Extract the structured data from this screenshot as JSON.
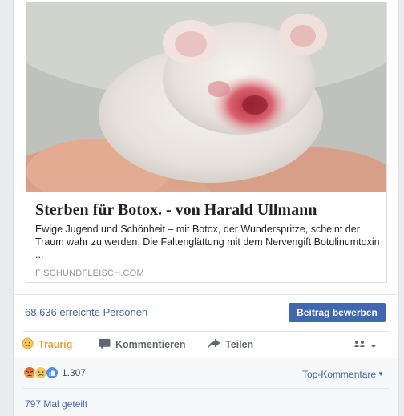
{
  "link": {
    "title": "Sterben für Botox. - von Harald Ullmann",
    "description": "Ewige Jugend und Schönheit – mit Botox, der Wunderspritze, scheint der Traum wahr zu werden. Die Faltenglättung mit dem Nervengift Botulinumtoxin ...",
    "source": "FISCHUNDFLEISCH.COM",
    "image": "white-mouse-with-inflamed-eye-photo"
  },
  "insights": {
    "reach": "68.636 erreichte Personen",
    "promote_label": "Beitrag bewerben"
  },
  "actions": {
    "reaction_label": "Traurig",
    "reaction_icon": "sad-emoji-icon",
    "comment_label": "Kommentieren",
    "comment_icon": "comment-bubble-icon",
    "share_label": "Teilen",
    "share_icon": "share-arrow-icon",
    "audience_icon": "friends-audience-icon"
  },
  "summary": {
    "reaction_count": "1.307",
    "reaction_icons": [
      "angry-reaction-icon",
      "sad-reaction-icon",
      "like-reaction-icon"
    ],
    "top_comments": "Top-Kommentare",
    "shares": "797 Mal geteilt"
  },
  "colors": {
    "link_blue": "#4267b2",
    "sad_yellow": "#e9a23b",
    "action_gray": "#606770",
    "background": "#e9ebee"
  }
}
